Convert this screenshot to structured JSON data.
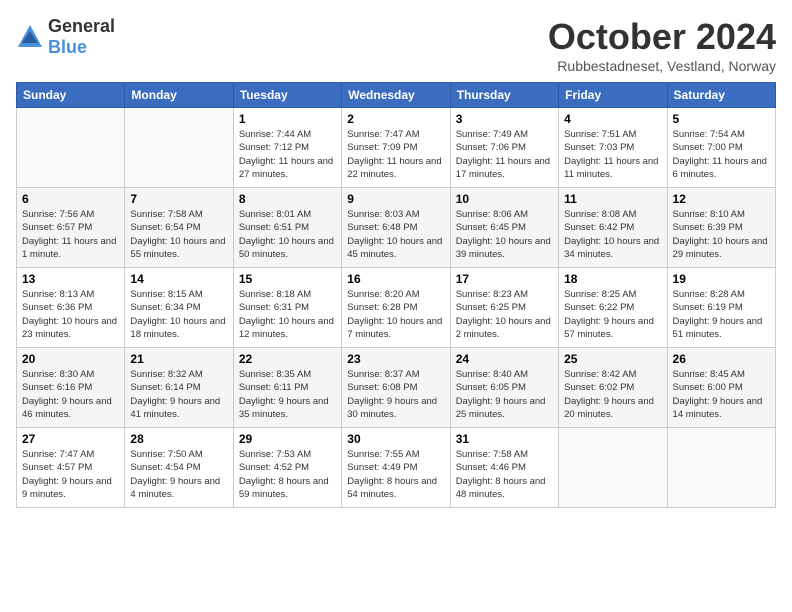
{
  "logo": {
    "general": "General",
    "blue": "Blue"
  },
  "title": "October 2024",
  "subtitle": "Rubbestadneset, Vestland, Norway",
  "days_of_week": [
    "Sunday",
    "Monday",
    "Tuesday",
    "Wednesday",
    "Thursday",
    "Friday",
    "Saturday"
  ],
  "weeks": [
    [
      {
        "day": "",
        "info": ""
      },
      {
        "day": "",
        "info": ""
      },
      {
        "day": "1",
        "info": "Sunrise: 7:44 AM\nSunset: 7:12 PM\nDaylight: 11 hours\nand 27 minutes."
      },
      {
        "day": "2",
        "info": "Sunrise: 7:47 AM\nSunset: 7:09 PM\nDaylight: 11 hours\nand 22 minutes."
      },
      {
        "day": "3",
        "info": "Sunrise: 7:49 AM\nSunset: 7:06 PM\nDaylight: 11 hours\nand 17 minutes."
      },
      {
        "day": "4",
        "info": "Sunrise: 7:51 AM\nSunset: 7:03 PM\nDaylight: 11 hours\nand 11 minutes."
      },
      {
        "day": "5",
        "info": "Sunrise: 7:54 AM\nSunset: 7:00 PM\nDaylight: 11 hours\nand 6 minutes."
      }
    ],
    [
      {
        "day": "6",
        "info": "Sunrise: 7:56 AM\nSunset: 6:57 PM\nDaylight: 11 hours\nand 1 minute."
      },
      {
        "day": "7",
        "info": "Sunrise: 7:58 AM\nSunset: 6:54 PM\nDaylight: 10 hours\nand 55 minutes."
      },
      {
        "day": "8",
        "info": "Sunrise: 8:01 AM\nSunset: 6:51 PM\nDaylight: 10 hours\nand 50 minutes."
      },
      {
        "day": "9",
        "info": "Sunrise: 8:03 AM\nSunset: 6:48 PM\nDaylight: 10 hours\nand 45 minutes."
      },
      {
        "day": "10",
        "info": "Sunrise: 8:06 AM\nSunset: 6:45 PM\nDaylight: 10 hours\nand 39 minutes."
      },
      {
        "day": "11",
        "info": "Sunrise: 8:08 AM\nSunset: 6:42 PM\nDaylight: 10 hours\nand 34 minutes."
      },
      {
        "day": "12",
        "info": "Sunrise: 8:10 AM\nSunset: 6:39 PM\nDaylight: 10 hours\nand 29 minutes."
      }
    ],
    [
      {
        "day": "13",
        "info": "Sunrise: 8:13 AM\nSunset: 6:36 PM\nDaylight: 10 hours\nand 23 minutes."
      },
      {
        "day": "14",
        "info": "Sunrise: 8:15 AM\nSunset: 6:34 PM\nDaylight: 10 hours\nand 18 minutes."
      },
      {
        "day": "15",
        "info": "Sunrise: 8:18 AM\nSunset: 6:31 PM\nDaylight: 10 hours\nand 12 minutes."
      },
      {
        "day": "16",
        "info": "Sunrise: 8:20 AM\nSunset: 6:28 PM\nDaylight: 10 hours\nand 7 minutes."
      },
      {
        "day": "17",
        "info": "Sunrise: 8:23 AM\nSunset: 6:25 PM\nDaylight: 10 hours\nand 2 minutes."
      },
      {
        "day": "18",
        "info": "Sunrise: 8:25 AM\nSunset: 6:22 PM\nDaylight: 9 hours\nand 57 minutes."
      },
      {
        "day": "19",
        "info": "Sunrise: 8:28 AM\nSunset: 6:19 PM\nDaylight: 9 hours\nand 51 minutes."
      }
    ],
    [
      {
        "day": "20",
        "info": "Sunrise: 8:30 AM\nSunset: 6:16 PM\nDaylight: 9 hours\nand 46 minutes."
      },
      {
        "day": "21",
        "info": "Sunrise: 8:32 AM\nSunset: 6:14 PM\nDaylight: 9 hours\nand 41 minutes."
      },
      {
        "day": "22",
        "info": "Sunrise: 8:35 AM\nSunset: 6:11 PM\nDaylight: 9 hours\nand 35 minutes."
      },
      {
        "day": "23",
        "info": "Sunrise: 8:37 AM\nSunset: 6:08 PM\nDaylight: 9 hours\nand 30 minutes."
      },
      {
        "day": "24",
        "info": "Sunrise: 8:40 AM\nSunset: 6:05 PM\nDaylight: 9 hours\nand 25 minutes."
      },
      {
        "day": "25",
        "info": "Sunrise: 8:42 AM\nSunset: 6:02 PM\nDaylight: 9 hours\nand 20 minutes."
      },
      {
        "day": "26",
        "info": "Sunrise: 8:45 AM\nSunset: 6:00 PM\nDaylight: 9 hours\nand 14 minutes."
      }
    ],
    [
      {
        "day": "27",
        "info": "Sunrise: 7:47 AM\nSunset: 4:57 PM\nDaylight: 9 hours\nand 9 minutes."
      },
      {
        "day": "28",
        "info": "Sunrise: 7:50 AM\nSunset: 4:54 PM\nDaylight: 9 hours\nand 4 minutes."
      },
      {
        "day": "29",
        "info": "Sunrise: 7:53 AM\nSunset: 4:52 PM\nDaylight: 8 hours\nand 59 minutes."
      },
      {
        "day": "30",
        "info": "Sunrise: 7:55 AM\nSunset: 4:49 PM\nDaylight: 8 hours\nand 54 minutes."
      },
      {
        "day": "31",
        "info": "Sunrise: 7:58 AM\nSunset: 4:46 PM\nDaylight: 8 hours\nand 48 minutes."
      },
      {
        "day": "",
        "info": ""
      },
      {
        "day": "",
        "info": ""
      }
    ]
  ]
}
